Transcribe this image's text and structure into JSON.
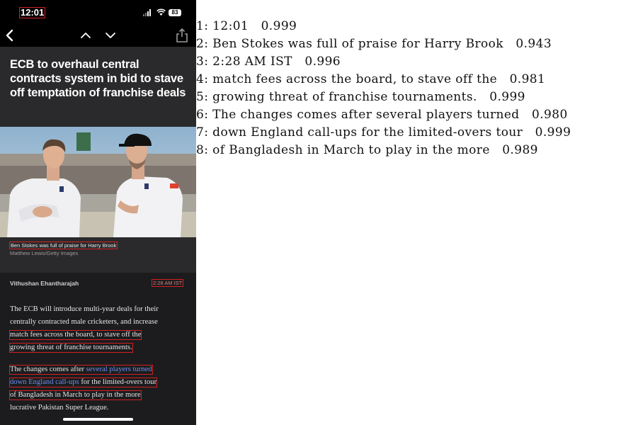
{
  "status_bar": {
    "time": "12:01",
    "battery": "83",
    "icons": [
      "signal-icon",
      "wifi-icon",
      "battery-icon"
    ]
  },
  "nav_bar": {
    "icons": [
      "back-chevron-icon",
      "up-chevron-icon",
      "down-chevron-icon",
      "share-icon"
    ]
  },
  "article": {
    "headline": "ECB to overhaul central contracts system in bid to stave off temptation of franchise deals",
    "photo_caption": "Ben Stokes was full of praise for Harry Brook",
    "photo_credit": "Matthew Lewis/Getty Images",
    "author": "Vithushan Ehantharajah",
    "timestamp": "2:28 AM IST",
    "paragraph1_lines": [
      "The ECB will introduce multi-year deals for their",
      "centrally contracted male cricketers, and increase",
      "match fees across the board, to stave off the",
      "growing threat of franchise tournaments."
    ],
    "paragraph2": {
      "line1_text": "The changes comes after ",
      "line1_link": "several players turned",
      "line2_link": "down England call-ups",
      "line2_text": " for the limited-overs tour",
      "line3": "of Bangladesh in March to play in the more",
      "line4": "lucrative Pakistan Super League."
    },
    "link_color": "#6f8ff0"
  },
  "ocr_results": [
    {
      "index": "1",
      "text": "12:01",
      "score": "0.999"
    },
    {
      "index": "2",
      "text": "Ben Stokes was full of praise for Harry Brook",
      "score": "0.943"
    },
    {
      "index": "3",
      "text": "2:28 AM IST",
      "score": "0.996"
    },
    {
      "index": "4",
      "text": "match fees across the board, to stave off the",
      "score": "0.981"
    },
    {
      "index": "5",
      "text": "growing threat of franchise tournaments.",
      "score": "0.999"
    },
    {
      "index": "6",
      "text": "The changes comes after several players turned",
      "score": "0.980"
    },
    {
      "index": "7",
      "text": "down England call-ups for the limited-overs tour",
      "score": "0.999"
    },
    {
      "index": "8",
      "text": "of Bangladesh in March to play in the more",
      "score": "0.989"
    }
  ]
}
